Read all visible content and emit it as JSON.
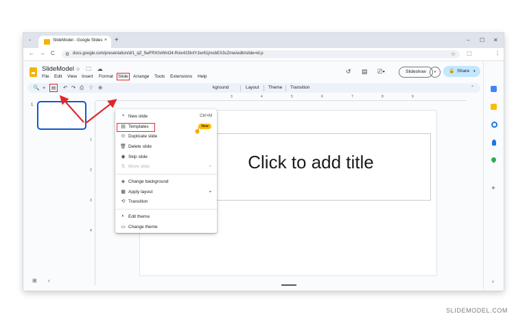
{
  "browser": {
    "tab_title": "SlideModel - Google Slides",
    "tab_close": "×",
    "new_tab": "+",
    "tab_dropdown": "⌄",
    "window_controls": [
      "−",
      "☐",
      "✕"
    ],
    "nav": [
      "←",
      "→",
      "C"
    ],
    "url": "docs.google.com/presentation/d/1_qZ_5wFRX0xWnO4-Roiv415tnIYJwr61jmsbEX3cZmw/edit#slide=id.p",
    "star": "☆",
    "extensions": "⬚",
    "more": "⋮"
  },
  "app": {
    "doc_title": "SlideModel",
    "title_icons": "☆ 🗀 ☁",
    "menu_items": [
      "File",
      "Edit",
      "View",
      "Insert",
      "Format",
      "Slide",
      "Arrange",
      "Tools",
      "Extensions",
      "Help"
    ],
    "slideshow_label": "Slideshow",
    "share_label": "Share",
    "share_icon": "lock-icon",
    "toolbar_text": [
      "kground",
      "Layout",
      "Theme",
      "Transition"
    ],
    "slide_number": "1",
    "title_placeholder": "Click to add title",
    "ruler_numbers": [
      "3",
      "4",
      "5",
      "6",
      "7",
      "8",
      "9"
    ],
    "vruler_numbers": [
      "1",
      "2",
      "3",
      "4"
    ]
  },
  "slide_menu": {
    "items": [
      {
        "icon": "+",
        "label": "New slide",
        "shortcut": "Ctrl+M"
      },
      {
        "icon": "▤",
        "label": "Templates",
        "badge": "New"
      },
      {
        "icon": "⊙",
        "label": "Duplicate slide"
      },
      {
        "icon": "🗑",
        "label": "Delete slide"
      },
      {
        "icon": "◉",
        "label": "Skip slide"
      },
      {
        "icon": "⇅",
        "label": "Move slide",
        "submenu": "▸",
        "disabled": true
      },
      {
        "icon": "◈",
        "label": "Change background"
      },
      {
        "icon": "▦",
        "label": "Apply layout",
        "submenu": "▸"
      },
      {
        "icon": "⟲",
        "label": "Transition"
      },
      {
        "icon": "◐",
        "label": "Edit theme"
      },
      {
        "icon": "▭",
        "label": "Change theme"
      }
    ]
  },
  "colors": {
    "highlight": "#e0282b",
    "accent": "#0b57d0",
    "slides_yellow": "#f4b400",
    "share_bg": "#c2e7ff"
  },
  "footer": "SLIDEMODEL.COM"
}
